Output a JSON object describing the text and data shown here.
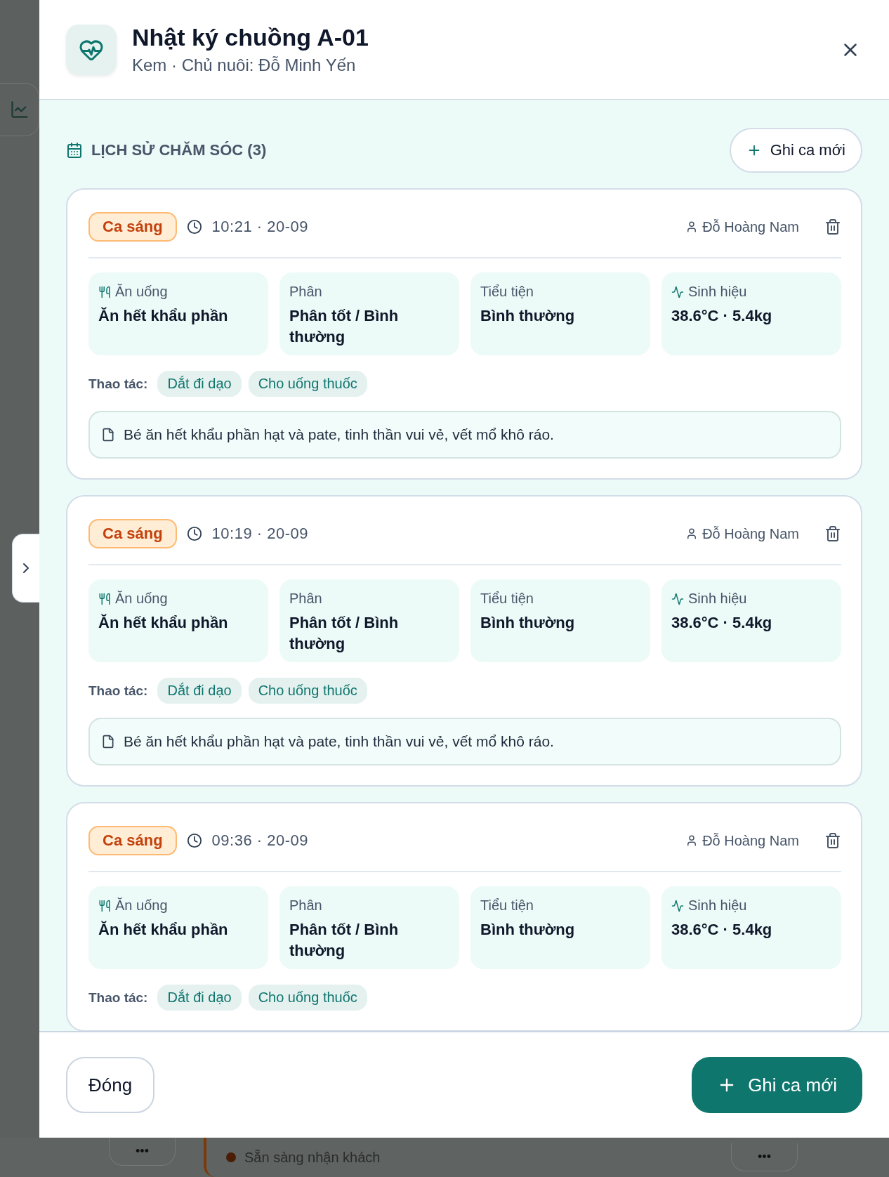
{
  "dialog": {
    "title": "Nhật ký chuồng A-01",
    "subtitle": "Kem · Chủ nuôi: Đỗ Minh Yến"
  },
  "history": {
    "title": "LỊCH SỬ CHĂM SÓC (3)",
    "add_button": "Ghi ca mới",
    "entries": [
      {
        "shift": "Ca sáng",
        "time": "10:21 · 20-09",
        "staff": "Đỗ Hoàng Nam",
        "metrics": [
          {
            "kind": "food",
            "label": "Ăn uống",
            "value": "Ăn hết khẩu phần"
          },
          {
            "kind": "plain",
            "label": "Phân",
            "value": "Phân tốt / Bình thường"
          },
          {
            "kind": "plain",
            "label": "Tiểu tiện",
            "value": "Bình thường"
          },
          {
            "kind": "vitals",
            "label": "Sinh hiệu",
            "value": "38.6°C · 5.4kg"
          }
        ],
        "actions_label": "Thao tác:",
        "actions": [
          "Dắt đi dạo",
          "Cho uống thuốc"
        ],
        "note": "Bé ăn hết khẩu phần hạt và pate, tinh thần vui vẻ, vết mổ khô ráo."
      },
      {
        "shift": "Ca sáng",
        "time": "10:19 · 20-09",
        "staff": "Đỗ Hoàng Nam",
        "metrics": [
          {
            "kind": "food",
            "label": "Ăn uống",
            "value": "Ăn hết khẩu phần"
          },
          {
            "kind": "plain",
            "label": "Phân",
            "value": "Phân tốt / Bình thường"
          },
          {
            "kind": "plain",
            "label": "Tiểu tiện",
            "value": "Bình thường"
          },
          {
            "kind": "vitals",
            "label": "Sinh hiệu",
            "value": "38.6°C · 5.4kg"
          }
        ],
        "actions_label": "Thao tác:",
        "actions": [
          "Dắt đi dạo",
          "Cho uống thuốc"
        ],
        "note": "Bé ăn hết khẩu phần hạt và pate, tinh thần vui vẻ, vết mổ khô ráo."
      },
      {
        "shift": "Ca sáng",
        "time": "09:36 · 20-09",
        "staff": "Đỗ Hoàng Nam",
        "metrics": [
          {
            "kind": "food",
            "label": "Ăn uống",
            "value": "Ăn hết khẩu phần"
          },
          {
            "kind": "plain",
            "label": "Phân",
            "value": "Phân tốt / Bình thường"
          },
          {
            "kind": "plain",
            "label": "Tiểu tiện",
            "value": "Bình thường"
          },
          {
            "kind": "vitals",
            "label": "Sinh hiệu",
            "value": "38.6°C · 5.4kg"
          }
        ],
        "actions_label": "Thao tác:",
        "actions": [
          "Dắt đi dạo",
          "Cho uống thuốc"
        ]
      }
    ]
  },
  "footer": {
    "close_button": "Đóng",
    "primary_button": "Ghi ca mới"
  },
  "background": {
    "status": "Sẵn sàng nhận khách",
    "more_buttons": [
      "•••",
      "•••"
    ]
  }
}
